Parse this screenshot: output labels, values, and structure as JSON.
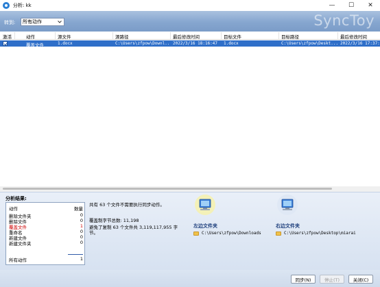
{
  "window": {
    "title": "分析: kk",
    "controls": {
      "minimize": "—",
      "maximize": "☐",
      "close": "✕"
    }
  },
  "header": {
    "goto_label": "转到:",
    "goto_selected": "所有动作",
    "brand": "SyncToy"
  },
  "table": {
    "columns": [
      "激活",
      "动作",
      "源文件",
      "源路径",
      "最后修改时间",
      "目标文件",
      "目标路径",
      "最后修改时间"
    ],
    "rows": [
      {
        "active": true,
        "action": "覆盖文件",
        "source_file": "1.docx",
        "source_path": "C:\\Users\\zfpow\\Downl...",
        "source_modified": "2022/3/16 18:16:47",
        "target_file": "1.docx",
        "target_path": "C:\\Users\\zfpow\\Deskt...",
        "target_modified": "2022/3/16 17:37:5"
      }
    ]
  },
  "results": {
    "title": "分析结果:",
    "stats_header": {
      "action": "动作",
      "count": "数量"
    },
    "stats": [
      {
        "label": "删除文件夹",
        "count": "0",
        "highlight": false
      },
      {
        "label": "删除文件",
        "count": "0",
        "highlight": false
      },
      {
        "label": "覆盖文件",
        "count": "1",
        "highlight": true
      },
      {
        "label": "重命名",
        "count": "0",
        "highlight": false
      },
      {
        "label": "新建文件",
        "count": "0",
        "highlight": false
      },
      {
        "label": "新建文件夹",
        "count": "0",
        "highlight": false
      }
    ],
    "total": {
      "label": "所有动作",
      "count": "1"
    },
    "message_line1": "共有 63 个文件不需要执行同步动作。",
    "message_line2": "覆盖制字节总数: 11,198",
    "message_line3": "避免了复制 63 个文件共 3,119,117,955 字",
    "message_line4": "节。",
    "left_folder": {
      "title": "左边文件夹",
      "path": "C:\\Users\\zfpow\\Downloads"
    },
    "right_folder": {
      "title": "右边文件夹",
      "path": "C:\\Users\\zfpow\\Desktop\\miarai"
    }
  },
  "buttons": {
    "sync": "同步(N)",
    "stop": "停止(T)",
    "close": "关闭(C)"
  },
  "colors": {
    "header_blue": "#86a6cf",
    "selection_blue": "#2f6fc9",
    "highlight_red": "#cc0000"
  }
}
